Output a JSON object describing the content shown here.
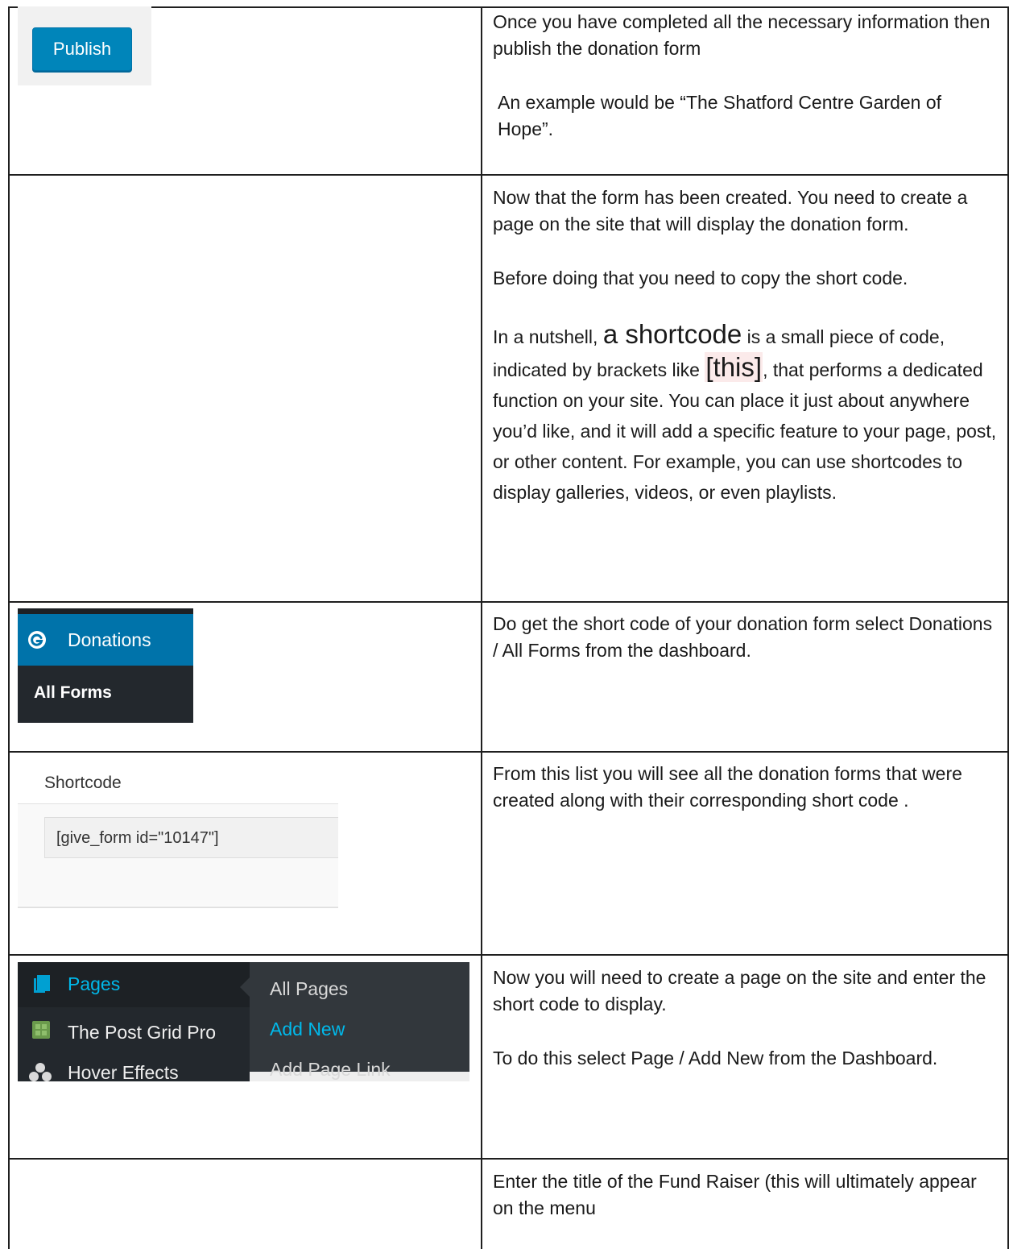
{
  "rows": [
    {
      "screenshot": {
        "button_label": "Publish"
      },
      "paragraphs": [
        "Once you have completed all the necessary information then publish the donation form",
        "An example would be “The Shatford Centre Garden of Hope”."
      ]
    },
    {
      "paragraphs": [
        "Now that the form has been created. You need to create a page on the site that will display the donation form.",
        "Before doing that you need to copy the short code."
      ],
      "shortcode_paragraph": {
        "prefix": "In a nutshell, ",
        "term": "a shortcode",
        "middle": " is a small piece of code, indicated by brackets like ",
        "example": "[this]",
        "suffix": ", that performs a dedicated function on your site. You can place it just about anywhere you’d like, and it will add a specific feature to your page, post, or other content. For example, you can use shortcodes to display galleries, videos, or even playlists."
      }
    },
    {
      "screenshot": {
        "menu_label": "Donations",
        "submenu_label": "All Forms",
        "icon": "give-logo-icon"
      },
      "paragraphs": [
        "Do get the short code of your donation form select Donations / All Forms from the dashboard."
      ]
    },
    {
      "screenshot": {
        "column_header": "Shortcode",
        "shortcode_value": "[give_form id=\"10147\"]"
      },
      "paragraphs": [
        "From this list you will see all the donation forms that were created along with their corresponding short code ."
      ]
    },
    {
      "screenshot": {
        "menu_items": [
          {
            "label": "Pages",
            "icon": "pages-icon"
          },
          {
            "label": "The Post Grid Pro",
            "icon": "post-grid-icon"
          },
          {
            "label": "Hover Effects",
            "icon": "hover-effects-icon"
          }
        ],
        "submenu_items": [
          "All Pages",
          "Add New",
          "Add Page Link"
        ]
      },
      "paragraphs": [
        "Now you will need to create a page on the site and enter the short code to display.",
        "To do this select Page / Add New from the Dashboard."
      ]
    },
    {
      "paragraphs": [
        "Enter the title of the Fund Raiser (this will ultimately appear on the menu"
      ]
    }
  ],
  "colors": {
    "wp_blue": "#0085ba",
    "wp_admin_dark": "#23282d",
    "wp_submenu_dark": "#32373c",
    "submenu_active_link": "#00b9eb",
    "menu_text": "#eeeeee",
    "highlight": "#fbeaea"
  }
}
